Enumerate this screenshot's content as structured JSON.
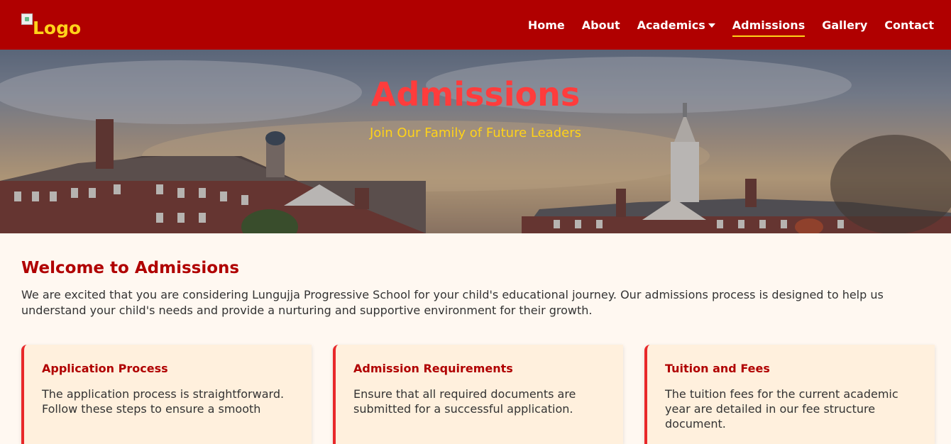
{
  "nav": {
    "logo_text": "Logo",
    "links": [
      {
        "label": "Home"
      },
      {
        "label": "About"
      },
      {
        "label": "Academics"
      },
      {
        "label": "Admissions"
      },
      {
        "label": "Gallery"
      },
      {
        "label": "Contact"
      }
    ],
    "active": "Admissions"
  },
  "hero": {
    "title": "Admissions",
    "subtitle": "Join Our Family of Future Leaders"
  },
  "welcome": {
    "title": "Welcome to Admissions",
    "text": "We are excited that you are considering Lungujja Progressive School for your child's educational journey. Our admissions process is designed to help us understand your child's needs and provide a nurturing and supportive environment for their growth."
  },
  "cards": [
    {
      "title": "Application Process",
      "text": "The application process is straightforward. Follow these steps to ensure a smooth"
    },
    {
      "title": "Admission Requirements",
      "text": "Ensure that all required documents are submitted for a successful application."
    },
    {
      "title": "Tuition and Fees",
      "text": "The tuition fees for the current academic year are detailed in our fee structure document."
    }
  ],
  "colors": {
    "brand": "#b00000",
    "accent": "#ffd21a",
    "hero_title": "#ff3c3c"
  }
}
